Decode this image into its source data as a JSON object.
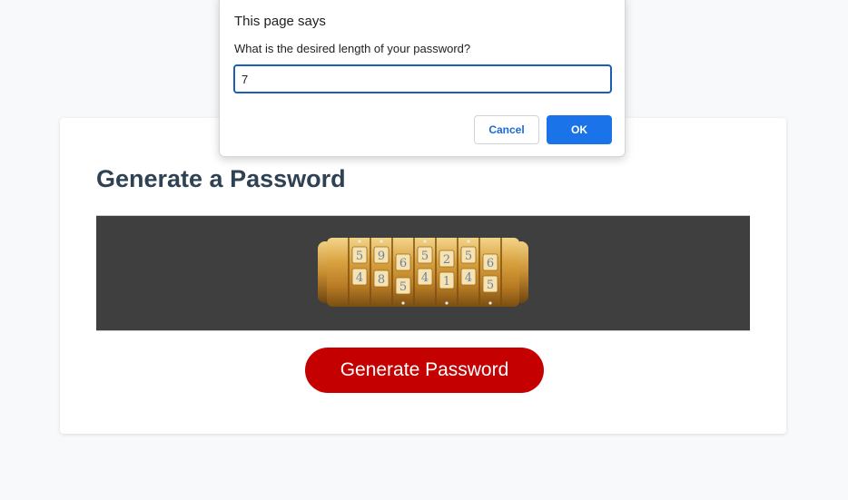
{
  "app": {
    "heading": "Generate a Password",
    "generate_button_label": "Generate Password",
    "button_color": "#c40000",
    "heading_color": "#2f4253",
    "banner_image": {
      "icon": "cryptex-lock-icon",
      "digits": [
        "5",
        "9",
        "6",
        "5",
        "2",
        "5",
        "7",
        "4",
        "8",
        "4",
        "1",
        "4",
        "6",
        "5",
        "3",
        "5",
        "1",
        "5"
      ]
    }
  },
  "dialog": {
    "title": "This page says",
    "message": "What is the desired length of your password?",
    "input_value": "7",
    "cancel_label": "Cancel",
    "ok_label": "OK",
    "accent_color": "#1a73e8"
  }
}
